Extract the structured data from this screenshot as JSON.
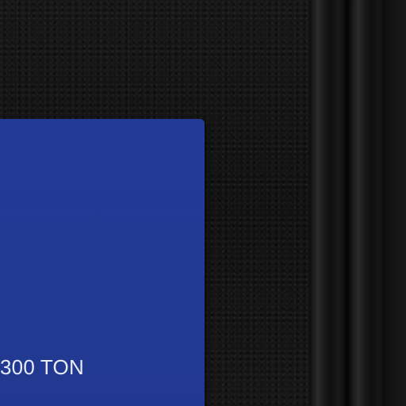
{
  "card": {
    "caption": "300 TON",
    "color": "#223b97"
  },
  "background": {
    "color": "#141414"
  }
}
